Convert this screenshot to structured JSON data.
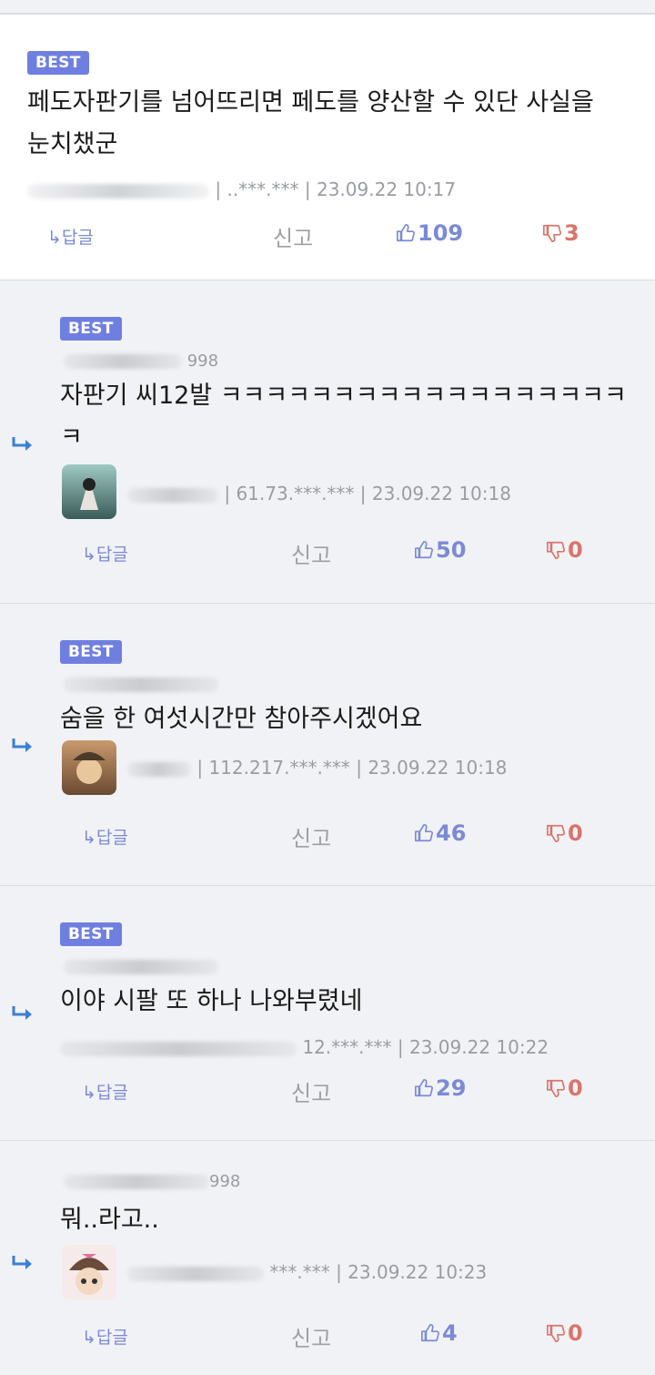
{
  "comments": [
    {
      "best_label": "BEST",
      "text_line1": "페도자판기를 넘어뜨리면 페도를 양산할 수 있단 사실을",
      "text_line2": "눈치챘군",
      "ip": "|  ..***.***",
      "date": "| 23.09.22 10:17",
      "reply_label": "↳답글",
      "report_label": "신고",
      "up": "109",
      "down": "3"
    },
    {
      "best_label": "BEST",
      "id_suffix": "  998",
      "text_line1": "자판기 씨12발 ㅋㅋㅋㅋㅋㅋㅋㅋㅋㅋㅋㅋㅋㅋㅋㅋㅋㅋ",
      "text_line2": "ㅋ",
      "ip": "| 61.73.***.***",
      "date": "| 23.09.22 10:18",
      "reply_label": "↳답글",
      "report_label": "신고",
      "up": "50",
      "down": "0"
    },
    {
      "best_label": "BEST",
      "text_line1": "숨을 한 여섯시간만 참아주시겠어요",
      "ip": "| 112.217.***.***",
      "date": "| 23.09.22 10:18",
      "reply_label": "↳답글",
      "report_label": "신고",
      "up": "46",
      "down": "0"
    },
    {
      "best_label": "BEST",
      "text_line1": "이야 시팔 또 하나 나와부렸네",
      "ip": "12.***.***",
      "date": "| 23.09.22 10:22",
      "reply_label": "↳답글",
      "report_label": "신고",
      "up": "29",
      "down": "0"
    },
    {
      "id_suffix": "998",
      "text_line1": "뭐..라고..",
      "ip": "***.***",
      "date": "| 23.09.22 10:23",
      "reply_label": "↳답글",
      "report_label": "신고",
      "up": "4",
      "down": "0"
    }
  ],
  "colors": {
    "best_badge": "#6f7fe0",
    "upvote": "#7b8ad6",
    "downvote": "#d9756b",
    "reply_bg": "#f1f2f5"
  },
  "icons": [
    "reply-arrow-icon",
    "thumbs-up-icon",
    "thumbs-down-icon",
    "avatar"
  ]
}
